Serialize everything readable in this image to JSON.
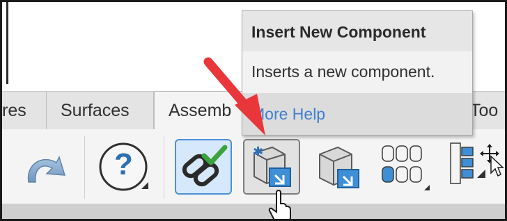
{
  "tabs": [
    {
      "label": "res"
    },
    {
      "label": "Surfaces"
    },
    {
      "label": "Assemb"
    },
    {
      "label": "Too"
    }
  ],
  "tooltip": {
    "title": "Insert New Component",
    "body": "Inserts a new component.",
    "help_link": "More Help"
  },
  "toolbar": {
    "tools": [
      {
        "icon": "redo-icon"
      },
      {
        "icon": "help-icon",
        "glyph": "?"
      },
      {
        "icon": "mate-link-icon",
        "state": "selected"
      },
      {
        "icon": "insert-new-component-icon",
        "state": "hover"
      },
      {
        "icon": "insert-components-icon"
      },
      {
        "icon": "pattern-icon"
      },
      {
        "icon": "feature-tree-icon"
      }
    ]
  },
  "colors": {
    "accent_arrow": "#e8363b",
    "selected_border": "#4a8fd8",
    "link": "#3f7fcf"
  }
}
